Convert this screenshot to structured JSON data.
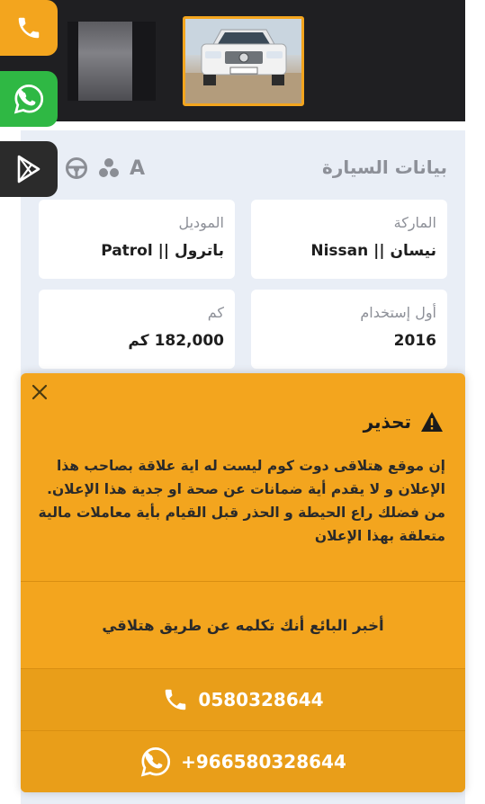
{
  "car_data": {
    "title": "بيانات السيارة",
    "attribute_icons": [
      "gear-stick-icon",
      "steering-wheel-icon",
      "fuel-icon",
      "transmission-a-icon"
    ],
    "transmission_letter": "A",
    "fields": [
      {
        "label": "الماركة",
        "value": "نيسان || Nissan"
      },
      {
        "label": "الموديل",
        "value": "باترول || Patrol"
      },
      {
        "label": "أول إستخدام",
        "value": "2016"
      },
      {
        "label": "كم",
        "value": "182,000 كم"
      }
    ]
  },
  "side_buttons": {
    "call": {
      "icon": "phone-icon",
      "color": "#f3a51e"
    },
    "whatsapp": {
      "icon": "whatsapp-icon",
      "color": "#2fb844"
    },
    "google_play": {
      "icon": "google-play-icon",
      "color": "#2b2b2b"
    }
  },
  "warning": {
    "title": "تحذير",
    "text": "إن موقع هتلاقى دوت كوم ليست له اية علاقة بصاحب هذا الإعلان و لا يقدم أية ضمانات عن صحة او جدية هذا الإعلان. من فضلك راع الحيطة و الحذر قبل القيام بأية معاملات مالية متعلقة بهذا الإعلان",
    "tell_seller": "أخبر البائع أنك تكلمه عن طريق هتلاقي",
    "phone": "0580328644",
    "whatsapp": "+966580328644"
  },
  "colors": {
    "accent": "#f3a51e",
    "accent_dark": "#e99e19",
    "whatsapp_green": "#2fb844",
    "panel_bg": "#e9eef6"
  }
}
